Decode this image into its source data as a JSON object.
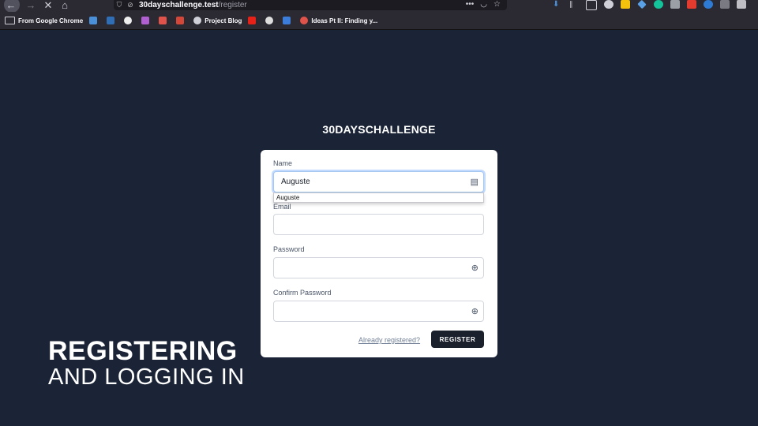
{
  "browser": {
    "url_host": "30dayschallenge.test",
    "url_path": "/register",
    "bookmarks": [
      {
        "label": "From Google Chrome",
        "color": "#cfcfd8"
      },
      {
        "label": "",
        "color": "#4a90d9"
      },
      {
        "label": "",
        "color": "#2f6db5"
      },
      {
        "label": "",
        "color": "#eeeeee"
      },
      {
        "label": "",
        "color": "#b05fd1"
      },
      {
        "label": "",
        "color": "#e0534a"
      },
      {
        "label": "",
        "color": "#d44638"
      },
      {
        "label": "Project Blog",
        "color": "#cfcfd8"
      },
      {
        "label": "",
        "color": "#e62117"
      },
      {
        "label": "",
        "color": "#dddddd"
      },
      {
        "label": "",
        "color": "#3b7dd8"
      },
      {
        "label": "Ideas Pt II: Finding y...",
        "color": "#e0534a"
      }
    ]
  },
  "page": {
    "brand": "30DAYSCHALLENGE"
  },
  "form": {
    "name_label": "Name",
    "name_value": "Auguste",
    "autofill_suggestion": "Auguste",
    "email_label": "Email",
    "email_value": "",
    "password_label": "Password",
    "password_value": "",
    "confirm_label": "Confirm Password",
    "confirm_value": "",
    "already_link": "Already registered?",
    "register_button": "REGISTER"
  },
  "overlay": {
    "line1": "REGISTERING",
    "line2": "AND LOGGING IN"
  },
  "colors": {
    "page_bg": "#1b2436",
    "button_bg": "#1a202c",
    "card_bg": "#ffffff"
  }
}
